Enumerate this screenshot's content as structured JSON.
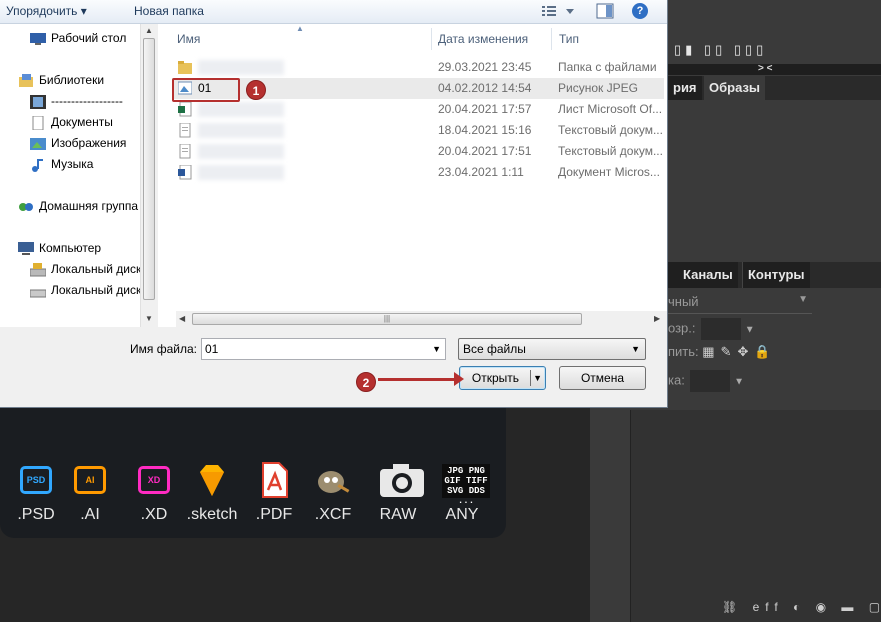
{
  "dialog": {
    "toolbar": {
      "organize": "Упорядочить ▾",
      "new_folder": "Новая папка"
    },
    "nav": {
      "desktop": "Рабочий стол",
      "libraries": "Библиотеки",
      "videos": "------------------",
      "documents": "Документы",
      "pictures": "Изображения",
      "music": "Музыка",
      "homegroup": "Домашняя группа",
      "computer": "Компьютер",
      "disk1": "Локальный диск",
      "disk2": "Локальный диск"
    },
    "columns": {
      "name": "Имя",
      "date": "Дата изменения",
      "type": "Тип"
    },
    "files": [
      {
        "name": "",
        "date": "29.03.2021 23:45",
        "type": "Папка с файлами",
        "icon": "folder-icon"
      },
      {
        "name": "01",
        "date": "04.02.2012 14:54",
        "type": "Рисунок JPEG",
        "icon": "image-file-icon"
      },
      {
        "name": "",
        "date": "20.04.2021 17:57",
        "type": "Лист Microsoft Of...",
        "icon": "excel-file-icon"
      },
      {
        "name": "",
        "date": "18.04.2021 15:16",
        "type": "Текстовый докум...",
        "icon": "text-file-icon"
      },
      {
        "name": "",
        "date": "20.04.2021 17:51",
        "type": "Текстовый докум...",
        "icon": "text-file-icon"
      },
      {
        "name": "",
        "date": "23.04.2021 1:11",
        "type": "Документ Micros...",
        "icon": "word-file-icon"
      }
    ],
    "filename_label": "Имя файла:",
    "filename_value": "01",
    "filetype_value": "Все файлы",
    "open_label": "Открыть",
    "cancel_label": "Отмена",
    "badges": [
      "1",
      "2"
    ]
  },
  "editor": {
    "collapse": "> <",
    "tabs_top": [
      "рия",
      "Образы"
    ],
    "tabs_layers": [
      "Каналы",
      "Контуры"
    ],
    "blend_mode": "чный",
    "opacity_label": "озр.:",
    "lock_label": "пить:",
    "fill_label": "ка:"
  },
  "formats": [
    {
      "label": ".PSD",
      "color": "#31a8ff",
      "icon": "psd-icon",
      "code": "PSD"
    },
    {
      "label": ".AI",
      "color": "#ff9a00",
      "icon": "ai-icon",
      "code": "AI"
    },
    {
      "label": ".XD",
      "color": "#ff2bc2",
      "icon": "xd-icon",
      "code": "XD"
    },
    {
      "label": ".sketch",
      "color": "#fdb300",
      "icon": "sketch-icon"
    },
    {
      "label": ".PDF",
      "color": "#e0402e",
      "icon": "pdf-icon"
    },
    {
      "label": ".XCF",
      "color": "#9c8d6f",
      "icon": "gimp-icon"
    },
    {
      "label": "RAW",
      "color": "#e8e8e8",
      "icon": "camera-icon"
    },
    {
      "label": "ANY",
      "color": "#ffffff",
      "icon": "any-format-icon",
      "code_lines": [
        "JPG PNG",
        "GIF TIFF",
        "SVG DDS",
        "..."
      ]
    }
  ]
}
